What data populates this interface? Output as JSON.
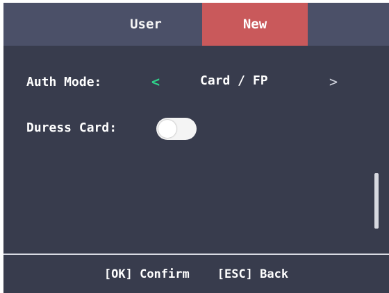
{
  "header": {
    "tabs": [
      {
        "label": "User",
        "active": false
      },
      {
        "label": "New",
        "active": true
      }
    ]
  },
  "form": {
    "auth_mode": {
      "label": "Auth Mode:",
      "prev_icon": "chevron-left-icon",
      "value": "Card / FP",
      "next_icon": "chevron-right-icon"
    },
    "duress_card": {
      "label": "Duress Card:",
      "enabled": false
    }
  },
  "footer": {
    "confirm": "[OK] Confirm",
    "back": "[ESC] Back"
  },
  "colors": {
    "background": "#383c4d",
    "header": "#4b5068",
    "active_tab": "#c9595b",
    "chevron_accent": "#2fd18a"
  }
}
